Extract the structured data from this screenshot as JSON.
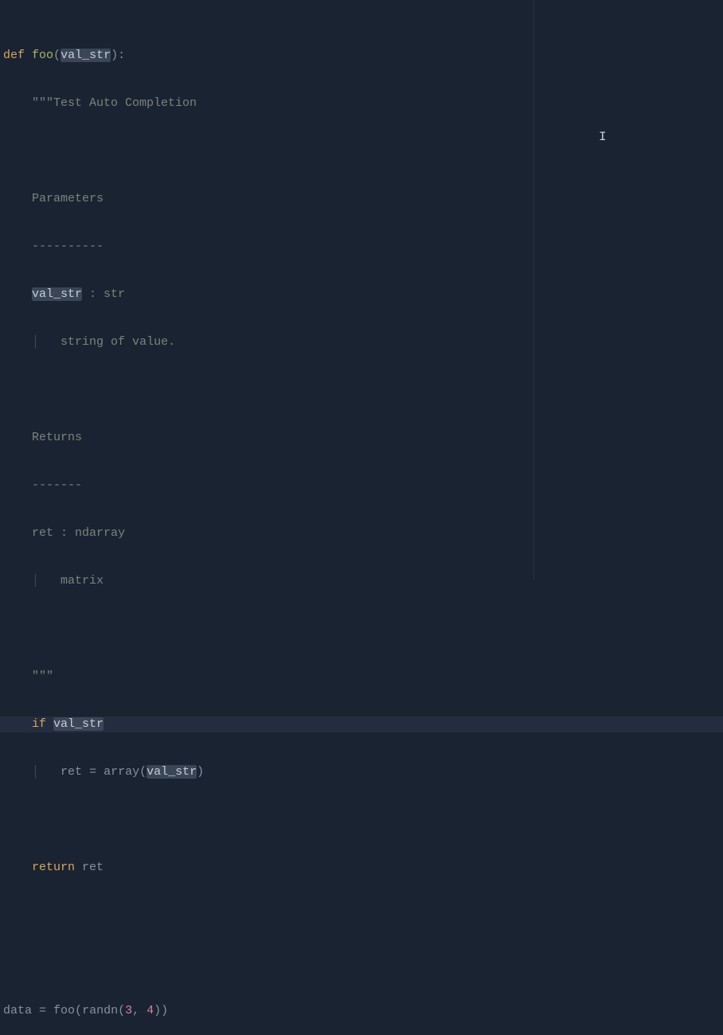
{
  "colors": {
    "background": "#1a2332",
    "foreground": "#c5cdd9",
    "keyword": "#d8a657",
    "function": "#a9b665",
    "docstring": "#7a8478",
    "number": "#d3869b",
    "highlight_bg": "#3a4556",
    "line_highlight": "#232d3f",
    "guide": "#2a3444",
    "comment_bar": "#3d4856",
    "identifier": "#889099"
  },
  "cursor_line_index": 14,
  "code": {
    "def_kw": "def",
    "fn_name": "foo",
    "paren_open": "(",
    "param_name": "val_str",
    "paren_close_colon": "):",
    "docstring_open": "\"\"\"",
    "docstring_title": "Test Auto Completion",
    "docstring_params_hdr": "Parameters",
    "docstring_params_dash": "----------",
    "docstring_param_name": "val_str",
    "docstring_param_type": " : str",
    "docstring_param_desc": "string of value.",
    "docstring_returns_hdr": "Returns",
    "docstring_returns_dash": "-------",
    "docstring_return_name": "ret : ndarray",
    "docstring_return_desc": "matrix",
    "docstring_close": "\"\"\"",
    "if_kw": "if",
    "if_cond": "val_str",
    "assign_lhs": "ret",
    "assign_eq": " = ",
    "assign_fn": "array",
    "assign_arg": "val_str",
    "return_kw": "return",
    "return_val": "ret",
    "call_lhs": "data",
    "call_eq": " = ",
    "call_fn": "foo",
    "call_inner_fn": "randn",
    "call_num1": "3",
    "call_comma": ",",
    "call_num2": "4",
    "call_close": "))",
    "indent1": "    ",
    "indent2": "        ",
    "bar": "│",
    "space": " "
  }
}
